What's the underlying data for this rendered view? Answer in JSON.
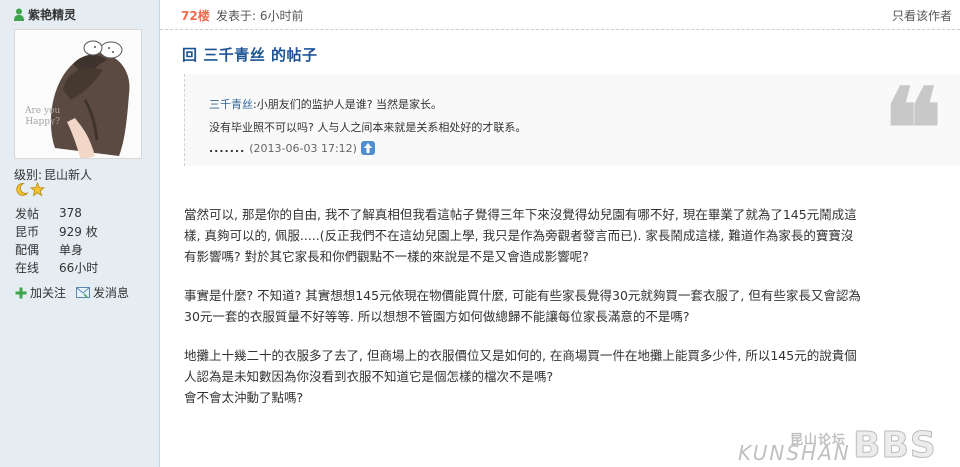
{
  "user": {
    "username": "紫艳精灵",
    "avatar_text_line1": "Are you",
    "avatar_text_line2": "Happy?",
    "level_label": "级别:",
    "level_value": "昆山新人",
    "stats": [
      {
        "label": "发帖",
        "value": "378"
      },
      {
        "label": "昆币",
        "value": "929 枚"
      },
      {
        "label": "配偶",
        "value": "单身"
      },
      {
        "label": "在线",
        "value": "66小时"
      }
    ],
    "actions": {
      "add_friend": "加关注",
      "send_message": "发消息"
    },
    "colors": {
      "sidebar_bg": "#e5edf2",
      "accent": "#1e5494"
    }
  },
  "post": {
    "floor": "72楼",
    "posted_at": "发表于: 6小时前",
    "only_author": "只看该作者",
    "title": "回 三千青丝 的帖子",
    "quote": {
      "author": "三千青丝",
      "line1": ":小朋友们的监护人是谁? 当然是家长。",
      "line2": "没有毕业照不可以吗? 人与人之间本来就是关系相处好的才联系。",
      "dots": ".......",
      "timestamp": "(2013-06-03 17:12)",
      "quote_mark": "❝"
    },
    "paragraphs": [
      {
        "lines": [
          "當然可以, 那是你的自由, 我不了解真相但我看這帖子覺得三年下來沒覺得幼兒園有哪不好, 現在畢業了就為了145元鬧成這",
          "樣, 真夠可以的, 佩服.....(反正我們不在這幼兒園上學, 我只是作為旁觀者發言而已). 家長鬧成這樣, 難道作為家長的寶寶沒",
          "有影響嗎? 對於其它家長和你們觀點不一樣的來說是不是又會造成影響呢?"
        ]
      },
      {
        "lines": [
          "事實是什麼? 不知道? 其實想想145元依現在物價能買什麼, 可能有些家長覺得30元就夠買一套衣服了, 但有些家長又會認為",
          "30元一套的衣服質量不好等等. 所以想想不管園方如何做總歸不能讓每位家長滿意的不是嗎?"
        ]
      },
      {
        "lines": [
          "地攤上十幾二十的衣服多了去了, 但商場上的衣服價位又是如何的, 在商場買一件在地攤上能買多少件, 所以145元的說貴個",
          "人認為是未知數因為你沒看到衣服不知道它是個怎樣的檔次不是嗎?",
          "會不會太沖動了點嗎?"
        ]
      }
    ]
  },
  "watermark": {
    "cn": "昆山论坛",
    "en": "KUNSHAN",
    "bbs": "BBS"
  }
}
